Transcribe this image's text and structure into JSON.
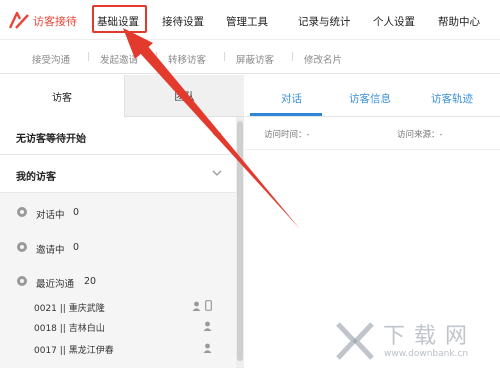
{
  "topnav": {
    "brand": "访客接待",
    "items": [
      "基础设置",
      "接待设置",
      "管理工具",
      "记录与统计",
      "个人设置",
      "帮助中心"
    ]
  },
  "subnav": {
    "items": [
      "接受沟通",
      "发起邀请",
      "转移访客",
      "屏蔽访客",
      "修改名片"
    ]
  },
  "left_panel": {
    "tabs": [
      "访客",
      "团队"
    ],
    "waiting_title": "无访客等待开始",
    "my_visitors_title": "我的访客",
    "statuses": [
      {
        "label": "对话中",
        "count": "0"
      },
      {
        "label": "邀请中",
        "count": "0"
      },
      {
        "label": "最近沟通",
        "count": "20"
      }
    ],
    "visitors": [
      "0021 || 重庆武隆",
      "0018 || 吉林白山",
      "0017 || 黑龙江伊春"
    ]
  },
  "right_panel": {
    "tabs": [
      "对话",
      "访客信息",
      "访客轨迹"
    ],
    "visit_time": "访问时间：-",
    "visit_source": "访问来源：-"
  },
  "watermark": {
    "text": "下载网",
    "url": "www.downbank.cn"
  },
  "colors": {
    "brand_red": "#e8463a",
    "accent_blue": "#3a8fd8",
    "highlight_red": "#e23b2e"
  }
}
